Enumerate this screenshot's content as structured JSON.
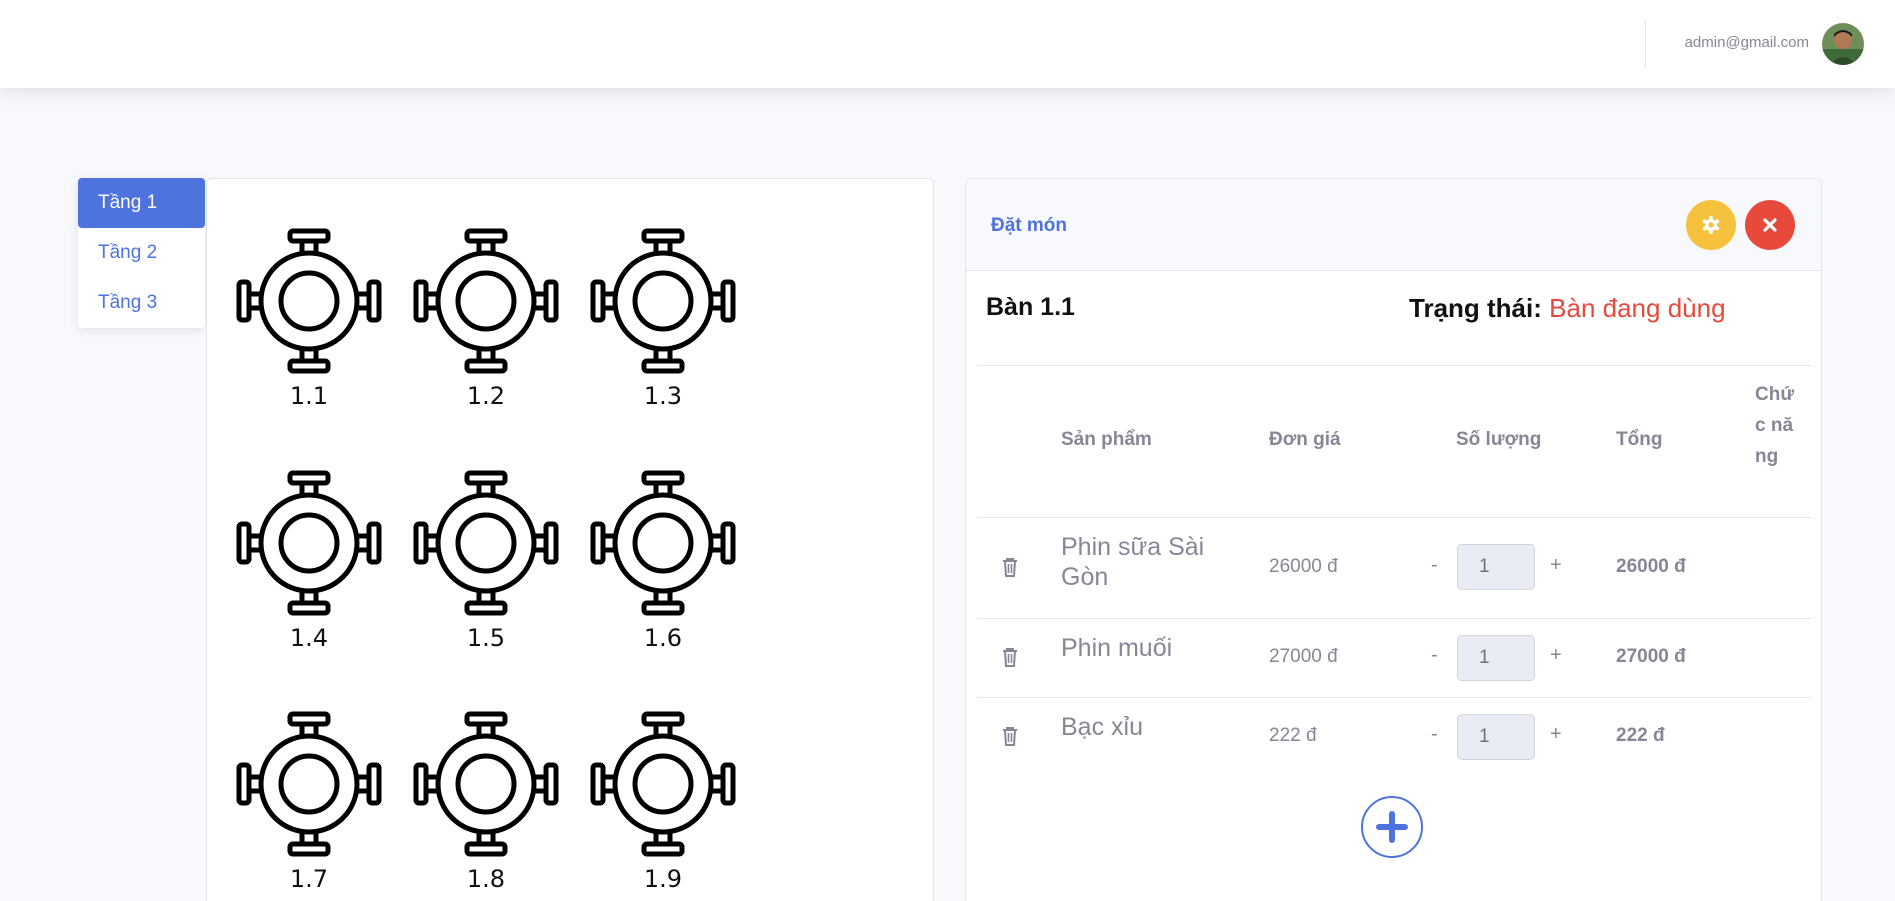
{
  "topbar": {
    "user_email": "admin@gmail.com"
  },
  "floors": [
    {
      "label": "Tầng 1",
      "active": true
    },
    {
      "label": "Tầng 2",
      "active": false
    },
    {
      "label": "Tầng 3",
      "active": false
    }
  ],
  "tables": [
    "1.1",
    "1.2",
    "1.3",
    "1.4",
    "1.5",
    "1.6",
    "1.7",
    "1.8",
    "1.9"
  ],
  "order": {
    "title": "Đặt món",
    "table_name": "Bàn 1.1",
    "status_label": "Trạng thái:",
    "status_value": "Bàn đang dùng",
    "headers": {
      "product": "Sản phẩm",
      "price": "Đơn giá",
      "quantity": "Số lượng",
      "total": "Tổng",
      "function": "Chức năng"
    },
    "items": [
      {
        "name": "Phin sữa Sài Gòn",
        "price": "26000 đ",
        "qty": "1",
        "total": "26000 đ"
      },
      {
        "name": "Phin muối",
        "price": "27000 đ",
        "qty": "1",
        "total": "27000 đ"
      },
      {
        "name": "Bạc xỉu",
        "price": "222 đ",
        "qty": "1",
        "total": "222 đ"
      }
    ],
    "minus_label": "-",
    "plus_label": "+"
  },
  "colors": {
    "primary": "#4e73df",
    "warning": "#f6c23e",
    "danger": "#e74a3b"
  }
}
